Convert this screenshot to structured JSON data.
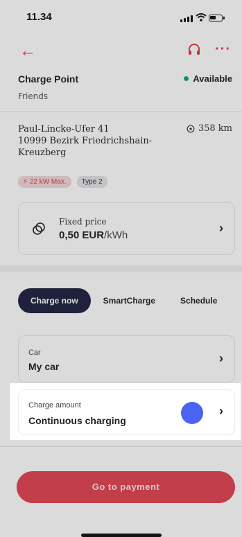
{
  "status_bar": {
    "time": "11.34"
  },
  "header": {
    "back_icon": "arrow-left-icon",
    "support_icon": "headset-icon",
    "more_icon": "more-dots-icon"
  },
  "charge_point": {
    "title": "Charge Point",
    "subtitle": "Friends",
    "status": "Available",
    "status_color": "#1aa36b",
    "address_line1": "Paul-Lincke-Ufer 41",
    "address_line2": "10999 Bezirk Friedrichshain-",
    "address_line3": "Kreuzberg",
    "distance": "358 km",
    "tags": [
      "22 kW Max.",
      "Type 2"
    ]
  },
  "price": {
    "label": "Fixed price",
    "amount": "0,50 EUR",
    "unit": "/kWh"
  },
  "tabs": [
    {
      "label": "Charge now",
      "active": true
    },
    {
      "label": "SmartCharge",
      "active": false
    },
    {
      "label": "Schedule",
      "active": false
    }
  ],
  "car": {
    "label": "Car",
    "value": "My car"
  },
  "charge_amount": {
    "label": "Charge amount",
    "value": "Continuous charging"
  },
  "payment_button": {
    "label": "Go to payment"
  },
  "colors": {
    "accent": "#e53b4a",
    "tab_active": "#1f2340",
    "touch_indicator": "#4a63f1"
  }
}
